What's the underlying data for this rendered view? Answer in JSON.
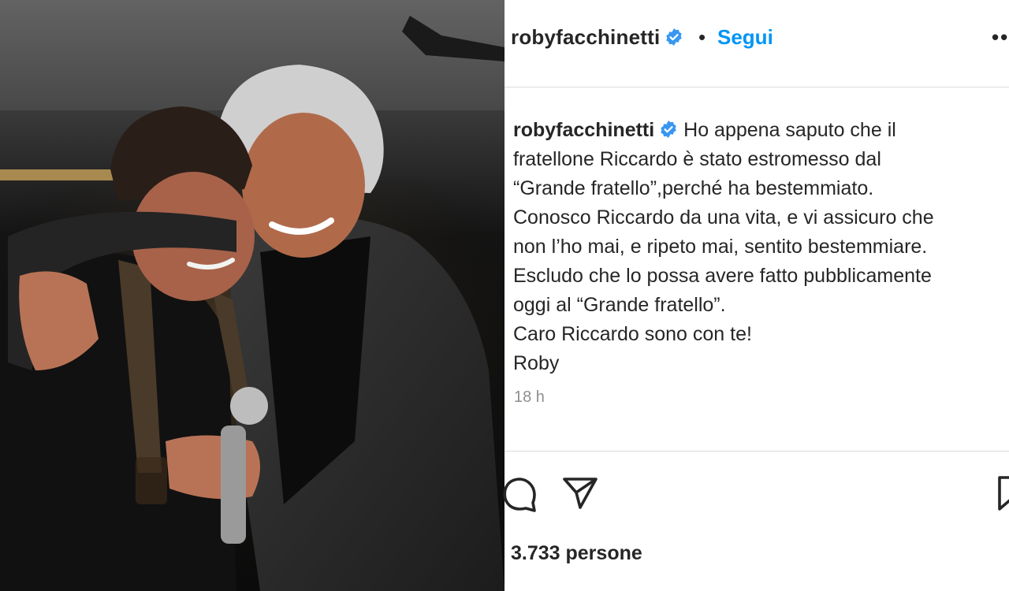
{
  "post": {
    "username": "robyfacchinetti",
    "follow_label": "Segui",
    "separator": "•",
    "more_label": "•••",
    "caption_lines": [
      "Ho appena saputo che il",
      "fratellone Riccardo è stato estromesso dal",
      "“Grande fratello”,perché ha bestemmiato.",
      "Conosco Riccardo da una vita, e vi assicuro che",
      "non l’ho mai, e ripeto mai, sentito bestemmiare.",
      "Escludo che lo possa avere fatto pubblicamente",
      "oggi al “Grande fratello”.",
      "Caro Riccardo sono con te!",
      "Roby"
    ],
    "timestamp": "18 h",
    "likes_text": "3.733 persone"
  },
  "icons": {
    "verified": "verified-badge-icon",
    "comment": "comment-icon",
    "share": "share-icon",
    "save": "save-icon"
  },
  "colors": {
    "follow": "#0095f6",
    "verified": "#3897f0",
    "text": "#262626",
    "muted": "#8e8e8e",
    "divider": "#dbdbdb"
  }
}
